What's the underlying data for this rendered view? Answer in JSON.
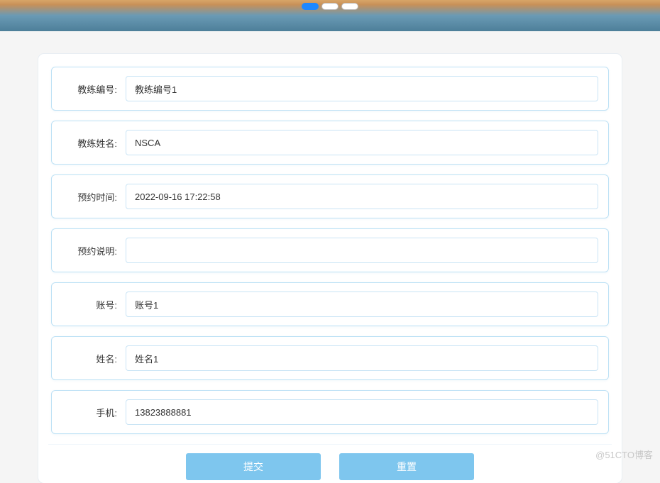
{
  "carousel": {
    "dots": 3,
    "activeIndex": 0
  },
  "form": {
    "fields": [
      {
        "key": "coach_no",
        "label": "教练编号:",
        "value": "教练编号1"
      },
      {
        "key": "coach_name",
        "label": "教练姓名:",
        "value": "NSCA"
      },
      {
        "key": "appt_time",
        "label": "预约时间:",
        "value": "2022-09-16 17:22:58"
      },
      {
        "key": "appt_desc",
        "label": "预约说明:",
        "value": ""
      },
      {
        "key": "account",
        "label": "账号:",
        "value": "账号1"
      },
      {
        "key": "name",
        "label": "姓名:",
        "value": "姓名1"
      },
      {
        "key": "phone",
        "label": "手机:",
        "value": "13823888881"
      }
    ],
    "buttons": {
      "submit": "提交",
      "reset": "重置"
    }
  },
  "watermark": "@51CTO博客"
}
